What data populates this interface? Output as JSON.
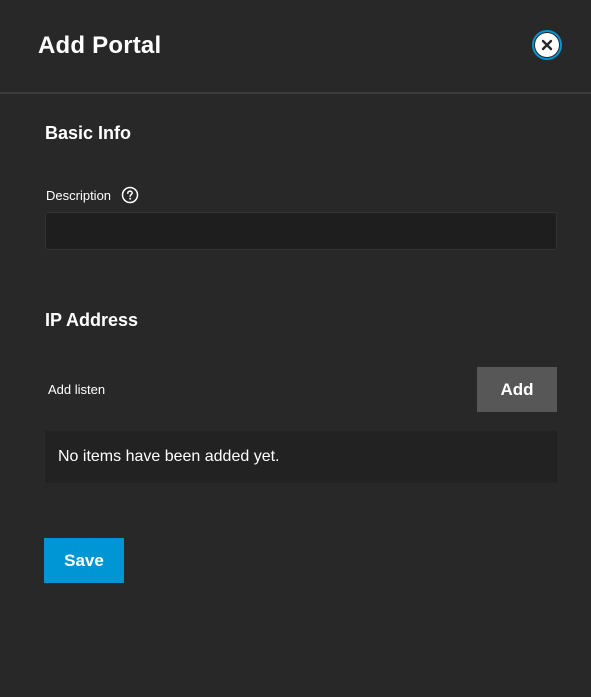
{
  "header": {
    "title": "Add Portal",
    "close_icon": "close-icon"
  },
  "basic_info": {
    "section_title": "Basic Info",
    "description_label": "Description",
    "description_help_icon": "help-circle-icon",
    "description_value": "",
    "description_placeholder": ""
  },
  "ip_address": {
    "section_title": "IP Address",
    "add_listen_label": "Add listen",
    "add_button_label": "Add",
    "empty_message": "No items have been added yet."
  },
  "footer": {
    "save_button_label": "Save"
  },
  "colors": {
    "background": "#282828",
    "accent": "#0095d5",
    "secondary_button": "#575757",
    "input_background": "#1e1e1e",
    "empty_box_background": "#222222"
  }
}
